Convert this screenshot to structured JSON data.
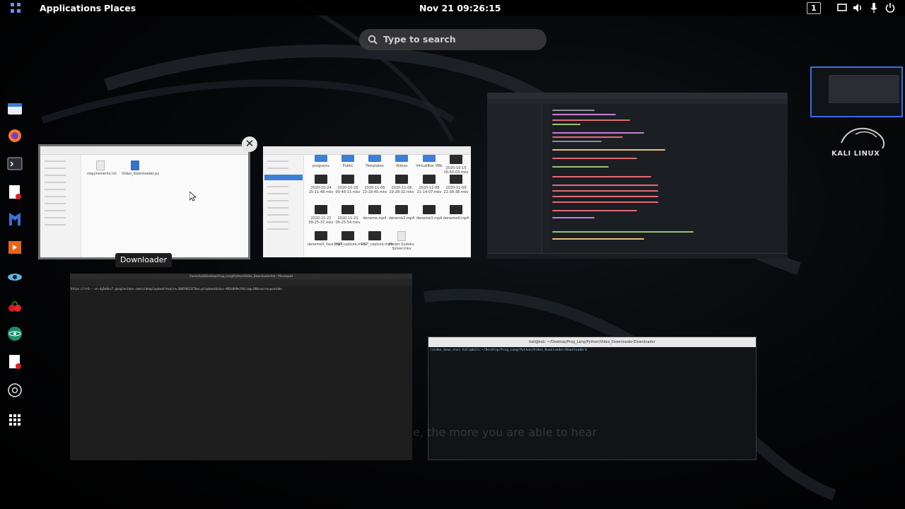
{
  "topbar": {
    "applications": "Applications",
    "places": "Places",
    "clock": "Nov 21  09:26:15",
    "workspace_number": "1"
  },
  "search": {
    "placeholder": "Type to search"
  },
  "dock": {
    "items": [
      "files",
      "firefox",
      "terminal",
      "text-editor",
      "metasploit",
      "burpsuite",
      "eye-tool",
      "cherry",
      "atom",
      "document",
      "settings",
      "show-apps"
    ]
  },
  "overview": {
    "hovered_window_label": "Downloader",
    "files1": {
      "items": [
        "requirements.txt",
        "Video_downloader.py"
      ]
    },
    "files2": {
      "folders": [
        "programs",
        "Public",
        "Templates",
        "Videos",
        "VirtualBox VMs",
        "2020-10-15 16-50-03.mkv"
      ],
      "row2": [
        "2020-10-24 15-11-48.mkv",
        "2020-10-26 00-48-15.mkv",
        "2020-11-06 13-18-40.mkv",
        "2020-11-06 19-28-32.mkv",
        "2020-11-06 21-14-07.mkv",
        "2020-11-09 21-38-38.mkv"
      ],
      "row3": [
        "2020-11-21 09-25-37.mkv",
        "2020-11-21 09-25-54.mkv",
        "deneme.mp4",
        "deneme2.mp4",
        "deneme3.mp4",
        "deneme4.mp4"
      ],
      "row4": [
        "deneme5_face.mp4",
        "DSP_capture.mkv",
        "DSP_capture.mp4",
        "Foster Sudoku Solver.mkv"
      ]
    },
    "terminal_title": "kali@kali: ~/Desktop/Prog_Lang/Python/Video_Downloader/Downloader",
    "terminal_prompt": "(video_down_env) kali@kali:~/Desktop/Prog_Lang/Python/Video_Downloader/Downloader$",
    "mousepad_title": "/home/kali/Desktop/Prog_Lang/Python/Video_Downloader/txt - Mousepad",
    "mousepad_text": "https://rr6---sn-4g5e6nz7.googlevideo.com/videoplayback?expire=1605961327&ei=playback&id=o-AB3c8d9e2f&itag=18&source=youtube"
  },
  "desktop": {
    "logo_text": "KALI LINUX",
    "bg_text": "e, the more you are able to hear"
  },
  "colors": {
    "accent": "#3a6ee8",
    "topbar": "#000000",
    "folder": "#3b7fd8"
  }
}
